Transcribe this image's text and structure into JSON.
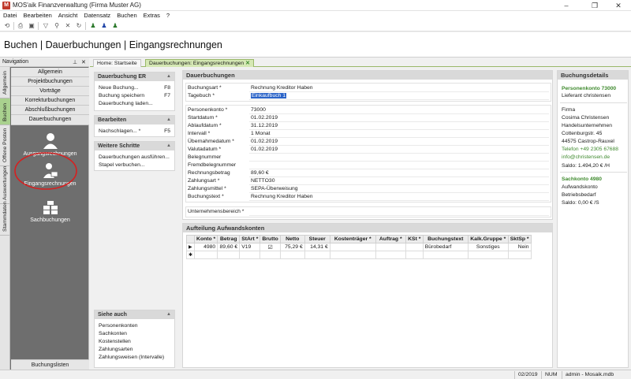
{
  "window": {
    "title": "MOS'aik Finanzverwaltung (Firma Muster AG)",
    "min": "–",
    "max": "❐",
    "close": "✕"
  },
  "menu": [
    "Datei",
    "Bearbeiten",
    "Ansicht",
    "Datensatz",
    "Buchen",
    "Extras",
    "?"
  ],
  "page_title": "Buchen | Dauerbuchungen | Eingangsrechnungen",
  "nav": {
    "header": "Navigation",
    "vertical_tabs": [
      "Allgemein",
      "Buchen",
      "Offene Posten",
      "Auswertungen",
      "Stammdaten"
    ],
    "items": [
      "Allgemein",
      "Projektbuchungen",
      "Vorträge",
      "Korrekturbuchungen",
      "Abschlußbuchungen",
      "Dauerbuchungen"
    ],
    "big_items": [
      "Ausgangsrechnungen",
      "Eingangsrechnungen",
      "Sachbuchungen"
    ],
    "footer": "Buchungslisten"
  },
  "tabs": [
    "Home: Startseite",
    "Dauerbuchungen: Eingangsrechnungen"
  ],
  "actions": {
    "dauerbuchung_er": {
      "title": "Dauerbuchung ER",
      "rows": [
        {
          "label": "Neue Buchung...",
          "key": "F8"
        },
        {
          "label": "Buchung speichern",
          "key": "F7"
        },
        {
          "label": "Dauerbuchung laden...",
          "key": ""
        }
      ]
    },
    "bearbeiten": {
      "title": "Bearbeiten",
      "rows": [
        {
          "label": "Nachschlagen... *",
          "key": "F5"
        }
      ]
    },
    "weitere": {
      "title": "Weitere Schritte",
      "rows": [
        {
          "label": "Dauerbuchungen ausführen..."
        },
        {
          "label": "Stapel verbuchen..."
        }
      ]
    },
    "siehe": {
      "title": "Siehe auch",
      "rows": [
        "Personenkonten",
        "Sachkonten",
        "Kostenstellen",
        "Zahlungsarten",
        "Zahlungsweisen (Intervalle)"
      ]
    }
  },
  "form": {
    "title": "Dauerbuchungen",
    "block1": [
      {
        "label": "Buchungsart *",
        "value": "Rechnung Kreditor Haben"
      },
      {
        "label": "Tagebuch *",
        "value": "Einkaufbuch 1"
      }
    ],
    "block2": [
      {
        "label": "Personenkonto *",
        "value": "73000"
      },
      {
        "label": "Startdatum *",
        "value": "01.02.2019"
      },
      {
        "label": "Ablaufdatum *",
        "value": "31.12.2019"
      },
      {
        "label": "Intervall *",
        "value": "1 Monat"
      },
      {
        "label": "Übernahmedatum *",
        "value": "01.02.2019"
      },
      {
        "label": "Valutadatum *",
        "value": "01.02.2019"
      },
      {
        "label": "Belegnummer",
        "value": ""
      },
      {
        "label": "Fremdbelegnummer",
        "value": ""
      },
      {
        "label": "Rechnungsbetrag",
        "value": "89,60 €"
      },
      {
        "label": "Zahlungsart *",
        "value": "NETTO30"
      },
      {
        "label": "Zahlungsmittel *",
        "value": "SEPA-Überweisung"
      },
      {
        "label": "Buchungstext *",
        "value": "Rechnung Kreditor Haben"
      }
    ],
    "block3": [
      {
        "label": "Unternehmensbereich *",
        "value": ""
      }
    ]
  },
  "grid": {
    "title": "Aufteilung Aufwandskonten",
    "columns": [
      "Konto *",
      "Betrag",
      "StArt *",
      "Brutto",
      "Netto",
      "Steuer",
      "Kostenträger *",
      "Auftrag *",
      "KSt *",
      "Buchungstext",
      "Kalk.Gruppe *",
      "SktSp *"
    ],
    "rows": [
      {
        "marker": "▶",
        "cells": [
          "4980",
          "89,60 €",
          "V19",
          "☑",
          "75,29 €",
          "14,31 €",
          "",
          "",
          "",
          "Bürobedarf",
          "Sonstiges",
          "Nein"
        ]
      }
    ],
    "new_row_marker": "✱"
  },
  "details": {
    "title": "Buchungsdetails",
    "person_title": "Personenkonto 73000",
    "person_name": "Lieferant christensen",
    "firma": [
      "Firma",
      "Cosima Christensen",
      "Handelsunternehmen",
      "Cottenburgstr. 45",
      "44575 Castrop-Rauxel"
    ],
    "telefon": "Telefon +49 2305 67688",
    "email": "info@christensen.de",
    "saldo1": "Saldo: 1.494,20 € /H",
    "sach_title": "Sachkonto 4980",
    "sach_lines": [
      "Aufwandskonto",
      "Betriebsbedarf",
      "Saldo: 0,00 € /S"
    ]
  },
  "status": {
    "period": "02/2019",
    "num": "NUM",
    "user": "admin - Mosaik.mdb"
  }
}
